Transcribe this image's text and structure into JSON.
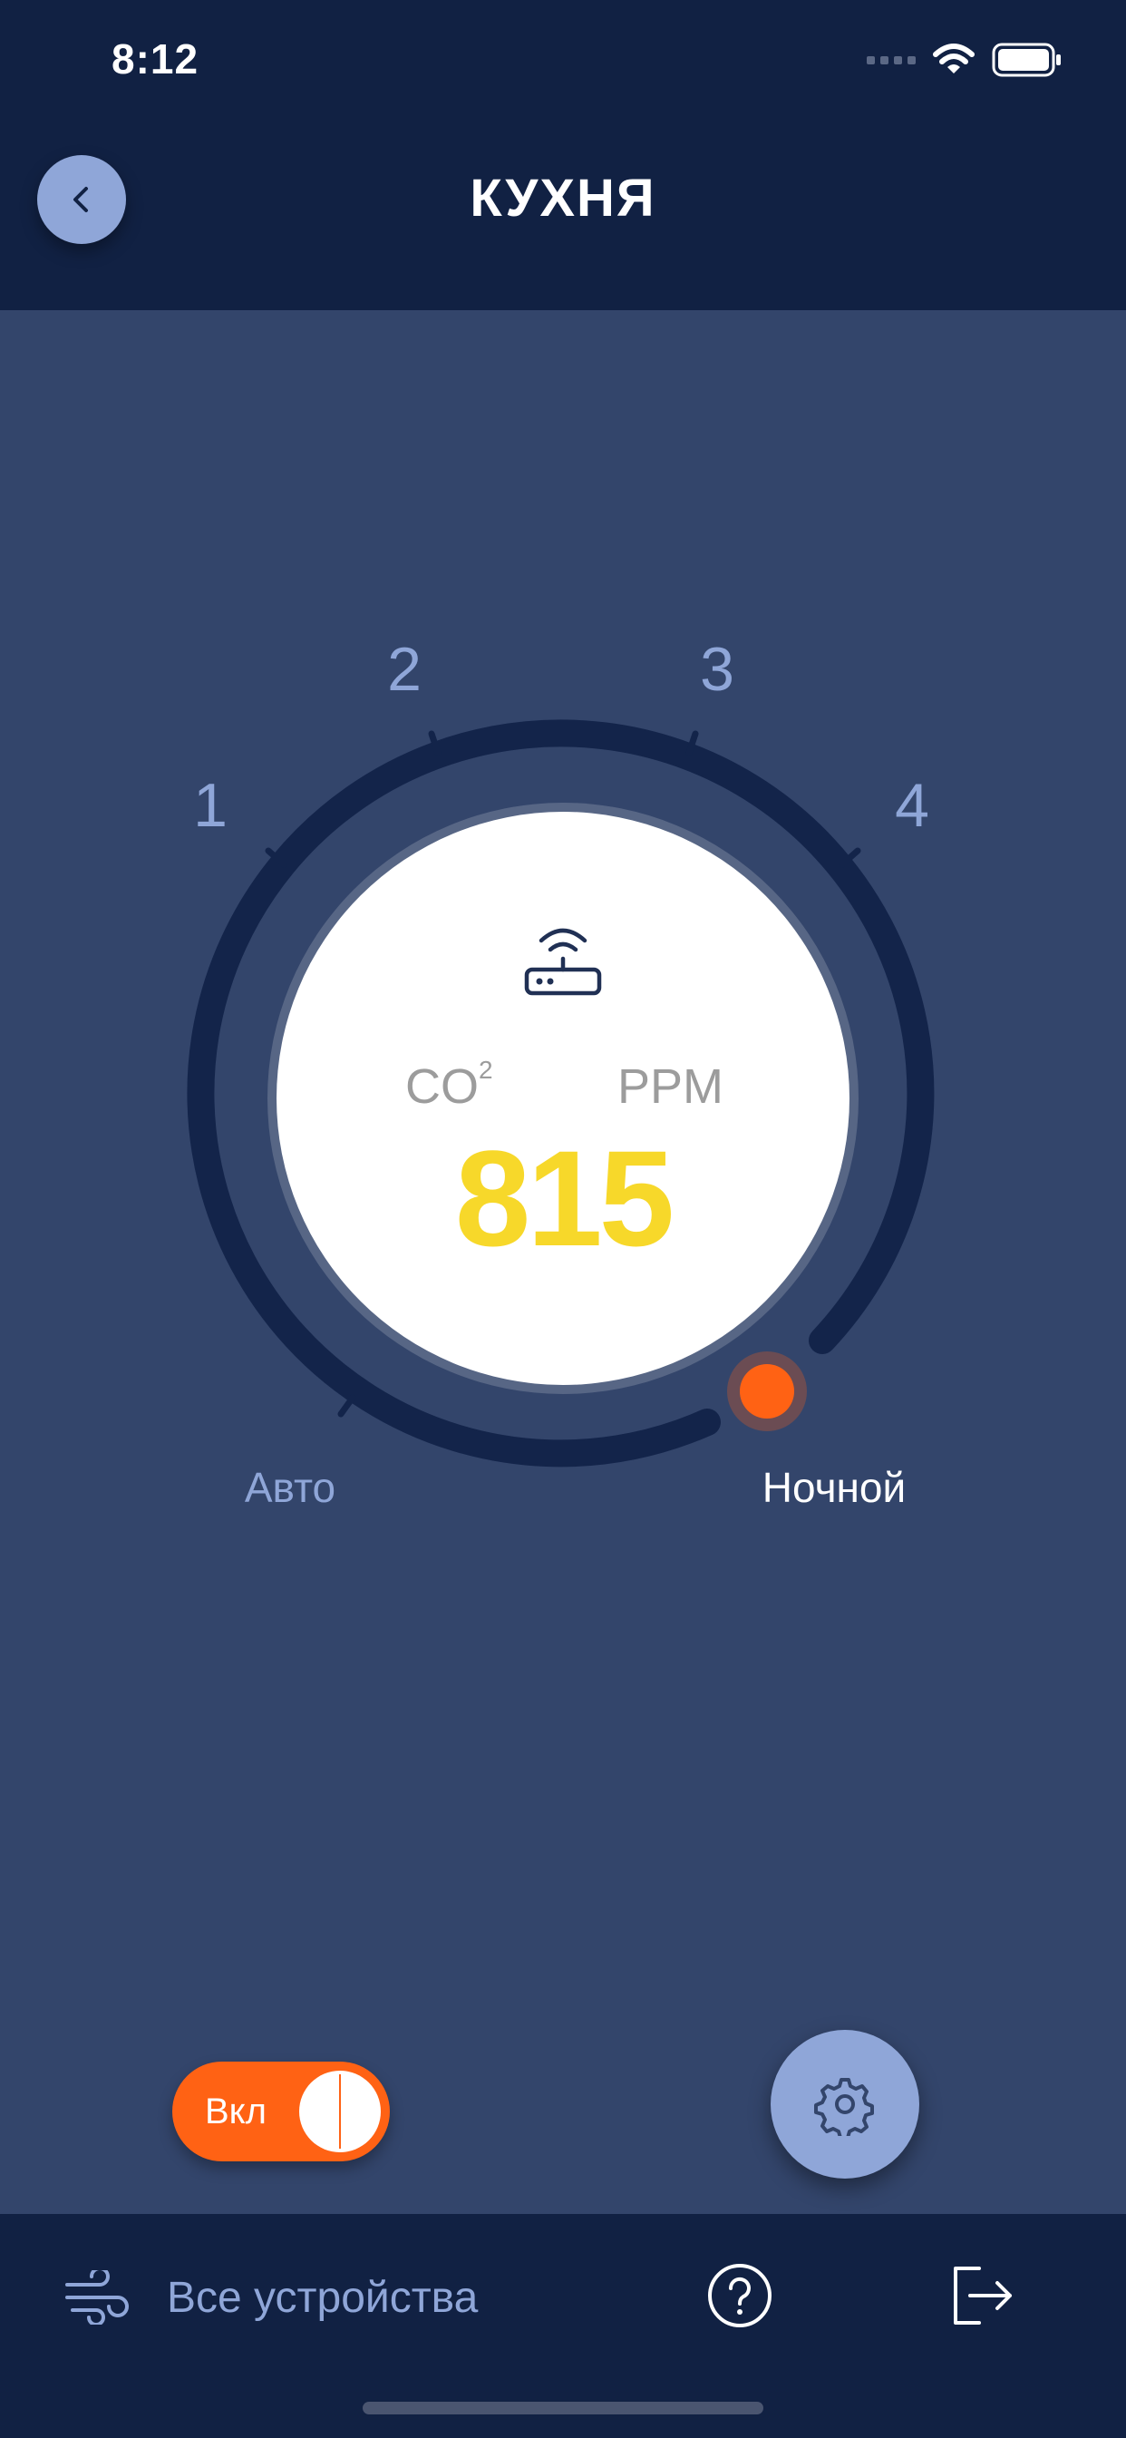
{
  "status_bar": {
    "time": "8:12"
  },
  "header": {
    "title": "КУХНЯ"
  },
  "dial": {
    "speeds": [
      "1",
      "2",
      "3",
      "4"
    ],
    "mode_auto": "Авто",
    "mode_night": "Ночной",
    "selected_mode": "Ночной"
  },
  "gauge": {
    "co2_label": "CO",
    "co2_superscript": "2",
    "unit_label": "PPM",
    "value": "815"
  },
  "controls": {
    "power_label": "Вкл",
    "power_on": true
  },
  "bottom_bar": {
    "all_devices_label": "Все устройства"
  },
  "colors": {
    "header_bg": "#112143",
    "page_bg": "#33456b",
    "accent": "#8fa6d8",
    "active_orange": "#ff6214",
    "value_yellow": "#f7d82a"
  },
  "icons": {
    "back": "chevron-left-icon",
    "router": "wifi-router-icon",
    "settings": "gear-icon",
    "fan": "wind-icon",
    "help": "question-circle-icon",
    "logout": "logout-icon"
  }
}
